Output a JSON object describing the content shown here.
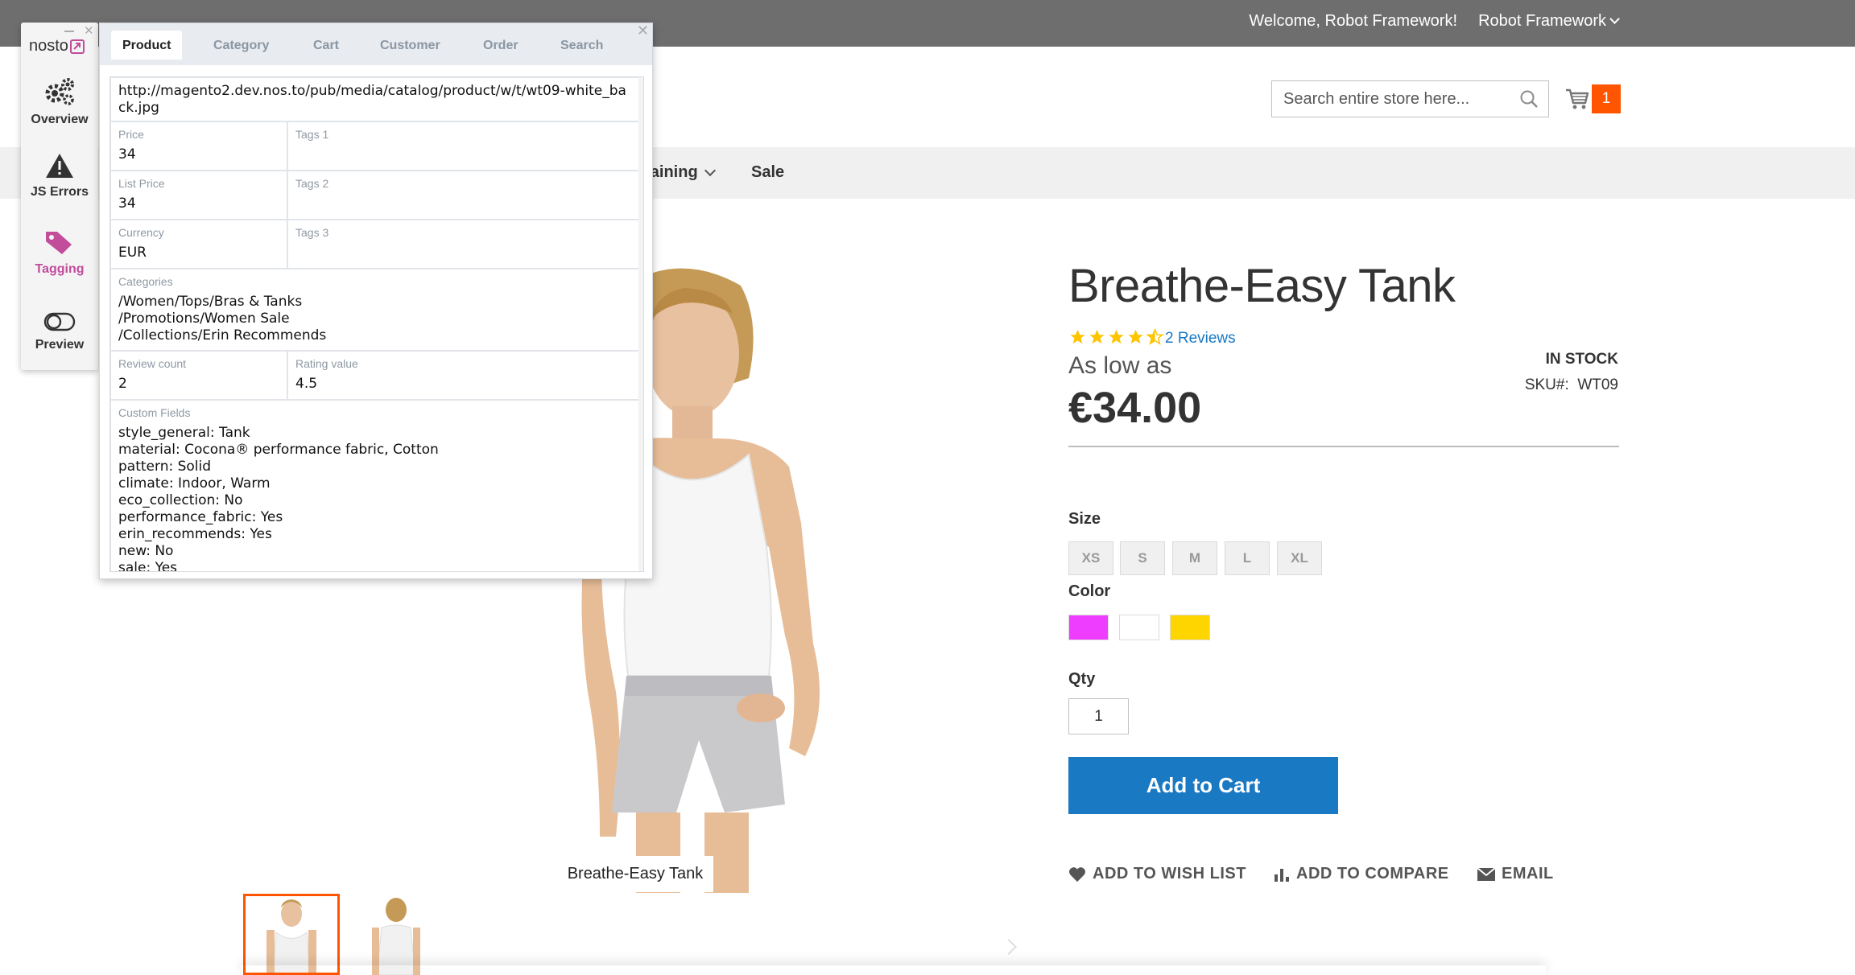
{
  "topbar": {
    "welcome": "Welcome, Robot Framework!",
    "account": "Robot Framework"
  },
  "header": {
    "search_placeholder": "Search entire store here...",
    "cart_count": "1"
  },
  "nav": {
    "items": [
      "raining",
      "Sale"
    ]
  },
  "product": {
    "title": "Breathe-Easy Tank",
    "rating_stars": 4.5,
    "reviews": "2 Reviews",
    "as_low_as": "As low as",
    "price": "€34.00",
    "stock": "IN STOCK",
    "sku_label": "SKU#:",
    "sku": "WT09",
    "image_label": "Breathe-Easy Tank",
    "size_label": "Size",
    "sizes": [
      "XS",
      "S",
      "M",
      "L",
      "XL"
    ],
    "color_label": "Color",
    "colors": [
      "#ef3dff",
      "#ffffff",
      "#ffd500"
    ],
    "qty_label": "Qty",
    "qty": "1",
    "add_to_cart": "Add to Cart",
    "actions": {
      "wishlist": "ADD TO WISH LIST",
      "compare": "ADD TO COMPARE",
      "email": "EMAIL"
    }
  },
  "nosto": {
    "logo": "nosto",
    "sidebar": {
      "overview": "Overview",
      "js_errors": "JS Errors",
      "tagging": "Tagging",
      "preview": "Preview"
    },
    "tabs": [
      "Product",
      "Category",
      "Cart",
      "Customer",
      "Order",
      "Search"
    ],
    "active_tab": "Product",
    "fields": {
      "image_url": "http://magento2.dev.nos.to/pub/media/catalog/product/w/t/wt09-white_back.jpg",
      "price_label": "Price",
      "price": "34",
      "tags1_label": "Tags 1",
      "list_price_label": "List Price",
      "list_price": "34",
      "tags2_label": "Tags 2",
      "currency_label": "Currency",
      "currency": "EUR",
      "tags3_label": "Tags 3",
      "categories_label": "Categories",
      "categories": "/Women/Tops/Bras & Tanks\n/Promotions/Women Sale\n/Collections/Erin Recommends",
      "review_count_label": "Review count",
      "review_count": "2",
      "rating_value_label": "Rating value",
      "rating_value": "4.5",
      "custom_fields_label": "Custom Fields",
      "custom_fields": "style_general: Tank\nmaterial: Cocona® performance fabric, Cotton\npattern: Solid\nclimate: Indoor, Warm\neco_collection: No\nperformance_fabric: Yes\nerin_recommends: Yes\nnew: No\nsale: Yes"
    }
  },
  "colors": {
    "accent_blue": "#1979c3",
    "cart_orange": "#ff5501",
    "nosto_pink": "#c14d9b"
  }
}
